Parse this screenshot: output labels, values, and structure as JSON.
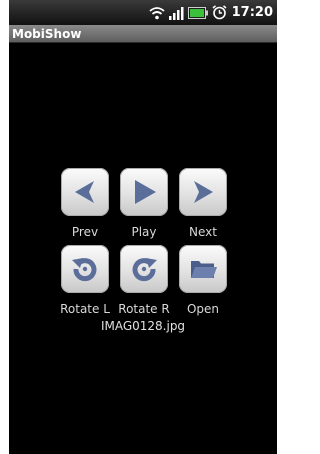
{
  "status_bar": {
    "time": "17:20",
    "icons": [
      "wifi-icon",
      "signal-icon",
      "battery-icon",
      "alarm-icon"
    ]
  },
  "app": {
    "title": "MobiShow"
  },
  "controls": {
    "prev_label": "Prev",
    "play_label": "Play",
    "next_label": "Next",
    "rotate_left_label": "Rotate L",
    "rotate_right_label": "Rotate R",
    "open_label": "Open"
  },
  "file": {
    "name": "IMAG0128.jpg"
  },
  "colors": {
    "background": "#000000",
    "icon_blue": "#5b6e9a",
    "button_face": "#e6e6e6"
  }
}
